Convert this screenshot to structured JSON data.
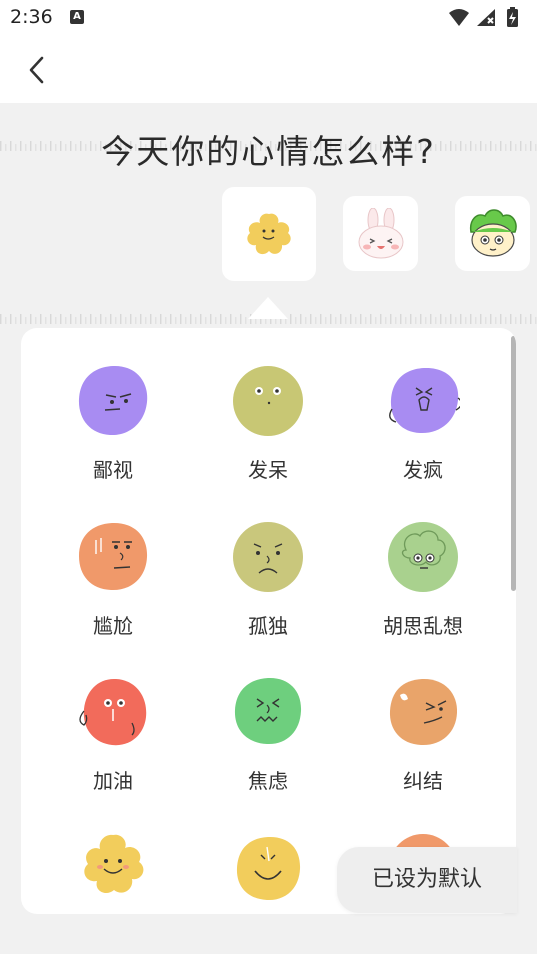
{
  "status_bar": {
    "time": "2:36",
    "notification_icon": "a-notification-icon",
    "icons": [
      "wifi-icon",
      "signal-icon",
      "battery-charging-icon"
    ]
  },
  "app_bar": {
    "back_icon": "chevron-left-icon"
  },
  "mood_picker": {
    "question": "今天你的心情怎么样?",
    "styles": [
      {
        "name": "flower-style",
        "selected": true
      },
      {
        "name": "bunny-style",
        "selected": false
      },
      {
        "name": "green-character-style",
        "selected": false
      }
    ],
    "moods": [
      {
        "label": "鄙视",
        "color": "#a88cf2"
      },
      {
        "label": "发呆",
        "color": "#c8c774"
      },
      {
        "label": "发疯",
        "color": "#a88cf2"
      },
      {
        "label": "尴尬",
        "color": "#f0996a"
      },
      {
        "label": "孤独",
        "color": "#c9c77c"
      },
      {
        "label": "胡思乱想",
        "color": "#a9d18e"
      },
      {
        "label": "加油",
        "color": "#f26b5b"
      },
      {
        "label": "焦虑",
        "color": "#6ecf7e"
      },
      {
        "label": "纠结",
        "color": "#e9a46a"
      },
      {
        "label": "",
        "color": "#f2cd5c"
      },
      {
        "label": "",
        "color": "#f2cd5c"
      },
      {
        "label": "",
        "color": "#f0996a"
      }
    ],
    "default_button": "已设为默认"
  }
}
